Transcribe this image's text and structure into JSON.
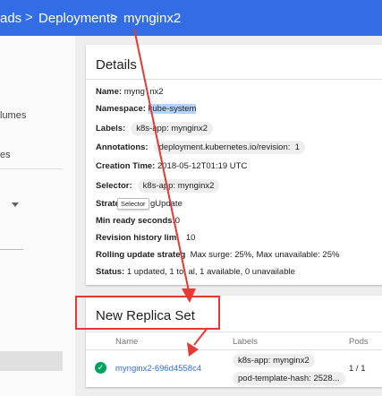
{
  "topbar": {
    "crumbs": [
      "ads",
      "Deployments",
      "myginx2"
    ],
    "crumb_current": "mynginx2"
  },
  "sidebar": {
    "items": [
      "lumes",
      "es"
    ]
  },
  "details": {
    "title": "Details",
    "name_label": "Name:",
    "name_value": "myng  nx2",
    "namespace_label": "Namespace:",
    "namespace_value": "kube-system",
    "labels_label": "Labels:",
    "labels_chip": "k8s-app: mynginx2",
    "annotations_label": "Annotations:",
    "annotations_chip": "deployment.kubernetes.io/revision:  1",
    "creation_label": "Creation Time:",
    "creation_value": "2018-05-12T01:19 UTC",
    "selector_label": "Selector:",
    "selector_chip": "k8s-app: mynginx2",
    "strategy_label": "Strate",
    "strategy_value": "gUpdate",
    "tooltip": "Selector",
    "minready_label": "Min ready seconds:",
    "minready_value": "0",
    "revision_label": "Revision history limi",
    "revision_value": "10",
    "rolling_label": "Rolling update strateg",
    "rolling_value": "Max surge: 25%, Max unavailable: 25%",
    "status_label": "Status:",
    "status_value": "1 updated, 1 to  al, 1 available, 0 unavailable"
  },
  "replica_set": {
    "title": "New Replica Set",
    "columns": [
      "Name",
      "Labels",
      "Pods"
    ],
    "rows": [
      {
        "name": "mynginx2-696d4558c4",
        "labels": [
          "k8s-app: mynginx2",
          "pod-template-hash: 2528..."
        ],
        "pods": "1 / 1"
      }
    ]
  },
  "colors": {
    "topbar": "#326de6",
    "annotation": "#e53935",
    "status_ok": "#00a35c"
  }
}
